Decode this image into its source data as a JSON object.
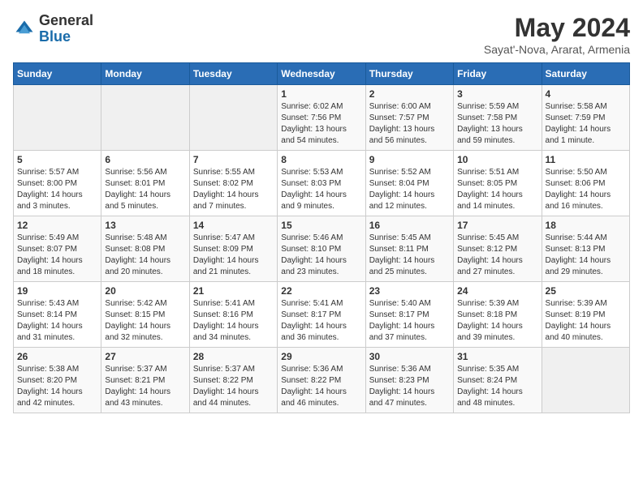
{
  "header": {
    "logo_general": "General",
    "logo_blue": "Blue",
    "month_title": "May 2024",
    "location": "Sayat'-Nova, Ararat, Armenia"
  },
  "weekdays": [
    "Sunday",
    "Monday",
    "Tuesday",
    "Wednesday",
    "Thursday",
    "Friday",
    "Saturday"
  ],
  "weeks": [
    [
      null,
      null,
      null,
      {
        "day": "1",
        "sunrise": "Sunrise: 6:02 AM",
        "sunset": "Sunset: 7:56 PM",
        "daylight": "Daylight: 13 hours and 54 minutes."
      },
      {
        "day": "2",
        "sunrise": "Sunrise: 6:00 AM",
        "sunset": "Sunset: 7:57 PM",
        "daylight": "Daylight: 13 hours and 56 minutes."
      },
      {
        "day": "3",
        "sunrise": "Sunrise: 5:59 AM",
        "sunset": "Sunset: 7:58 PM",
        "daylight": "Daylight: 13 hours and 59 minutes."
      },
      {
        "day": "4",
        "sunrise": "Sunrise: 5:58 AM",
        "sunset": "Sunset: 7:59 PM",
        "daylight": "Daylight: 14 hours and 1 minute."
      }
    ],
    [
      {
        "day": "5",
        "sunrise": "Sunrise: 5:57 AM",
        "sunset": "Sunset: 8:00 PM",
        "daylight": "Daylight: 14 hours and 3 minutes."
      },
      {
        "day": "6",
        "sunrise": "Sunrise: 5:56 AM",
        "sunset": "Sunset: 8:01 PM",
        "daylight": "Daylight: 14 hours and 5 minutes."
      },
      {
        "day": "7",
        "sunrise": "Sunrise: 5:55 AM",
        "sunset": "Sunset: 8:02 PM",
        "daylight": "Daylight: 14 hours and 7 minutes."
      },
      {
        "day": "8",
        "sunrise": "Sunrise: 5:53 AM",
        "sunset": "Sunset: 8:03 PM",
        "daylight": "Daylight: 14 hours and 9 minutes."
      },
      {
        "day": "9",
        "sunrise": "Sunrise: 5:52 AM",
        "sunset": "Sunset: 8:04 PM",
        "daylight": "Daylight: 14 hours and 12 minutes."
      },
      {
        "day": "10",
        "sunrise": "Sunrise: 5:51 AM",
        "sunset": "Sunset: 8:05 PM",
        "daylight": "Daylight: 14 hours and 14 minutes."
      },
      {
        "day": "11",
        "sunrise": "Sunrise: 5:50 AM",
        "sunset": "Sunset: 8:06 PM",
        "daylight": "Daylight: 14 hours and 16 minutes."
      }
    ],
    [
      {
        "day": "12",
        "sunrise": "Sunrise: 5:49 AM",
        "sunset": "Sunset: 8:07 PM",
        "daylight": "Daylight: 14 hours and 18 minutes."
      },
      {
        "day": "13",
        "sunrise": "Sunrise: 5:48 AM",
        "sunset": "Sunset: 8:08 PM",
        "daylight": "Daylight: 14 hours and 20 minutes."
      },
      {
        "day": "14",
        "sunrise": "Sunrise: 5:47 AM",
        "sunset": "Sunset: 8:09 PM",
        "daylight": "Daylight: 14 hours and 21 minutes."
      },
      {
        "day": "15",
        "sunrise": "Sunrise: 5:46 AM",
        "sunset": "Sunset: 8:10 PM",
        "daylight": "Daylight: 14 hours and 23 minutes."
      },
      {
        "day": "16",
        "sunrise": "Sunrise: 5:45 AM",
        "sunset": "Sunset: 8:11 PM",
        "daylight": "Daylight: 14 hours and 25 minutes."
      },
      {
        "day": "17",
        "sunrise": "Sunrise: 5:45 AM",
        "sunset": "Sunset: 8:12 PM",
        "daylight": "Daylight: 14 hours and 27 minutes."
      },
      {
        "day": "18",
        "sunrise": "Sunrise: 5:44 AM",
        "sunset": "Sunset: 8:13 PM",
        "daylight": "Daylight: 14 hours and 29 minutes."
      }
    ],
    [
      {
        "day": "19",
        "sunrise": "Sunrise: 5:43 AM",
        "sunset": "Sunset: 8:14 PM",
        "daylight": "Daylight: 14 hours and 31 minutes."
      },
      {
        "day": "20",
        "sunrise": "Sunrise: 5:42 AM",
        "sunset": "Sunset: 8:15 PM",
        "daylight": "Daylight: 14 hours and 32 minutes."
      },
      {
        "day": "21",
        "sunrise": "Sunrise: 5:41 AM",
        "sunset": "Sunset: 8:16 PM",
        "daylight": "Daylight: 14 hours and 34 minutes."
      },
      {
        "day": "22",
        "sunrise": "Sunrise: 5:41 AM",
        "sunset": "Sunset: 8:17 PM",
        "daylight": "Daylight: 14 hours and 36 minutes."
      },
      {
        "day": "23",
        "sunrise": "Sunrise: 5:40 AM",
        "sunset": "Sunset: 8:17 PM",
        "daylight": "Daylight: 14 hours and 37 minutes."
      },
      {
        "day": "24",
        "sunrise": "Sunrise: 5:39 AM",
        "sunset": "Sunset: 8:18 PM",
        "daylight": "Daylight: 14 hours and 39 minutes."
      },
      {
        "day": "25",
        "sunrise": "Sunrise: 5:39 AM",
        "sunset": "Sunset: 8:19 PM",
        "daylight": "Daylight: 14 hours and 40 minutes."
      }
    ],
    [
      {
        "day": "26",
        "sunrise": "Sunrise: 5:38 AM",
        "sunset": "Sunset: 8:20 PM",
        "daylight": "Daylight: 14 hours and 42 minutes."
      },
      {
        "day": "27",
        "sunrise": "Sunrise: 5:37 AM",
        "sunset": "Sunset: 8:21 PM",
        "daylight": "Daylight: 14 hours and 43 minutes."
      },
      {
        "day": "28",
        "sunrise": "Sunrise: 5:37 AM",
        "sunset": "Sunset: 8:22 PM",
        "daylight": "Daylight: 14 hours and 44 minutes."
      },
      {
        "day": "29",
        "sunrise": "Sunrise: 5:36 AM",
        "sunset": "Sunset: 8:22 PM",
        "daylight": "Daylight: 14 hours and 46 minutes."
      },
      {
        "day": "30",
        "sunrise": "Sunrise: 5:36 AM",
        "sunset": "Sunset: 8:23 PM",
        "daylight": "Daylight: 14 hours and 47 minutes."
      },
      {
        "day": "31",
        "sunrise": "Sunrise: 5:35 AM",
        "sunset": "Sunset: 8:24 PM",
        "daylight": "Daylight: 14 hours and 48 minutes."
      },
      null
    ]
  ]
}
